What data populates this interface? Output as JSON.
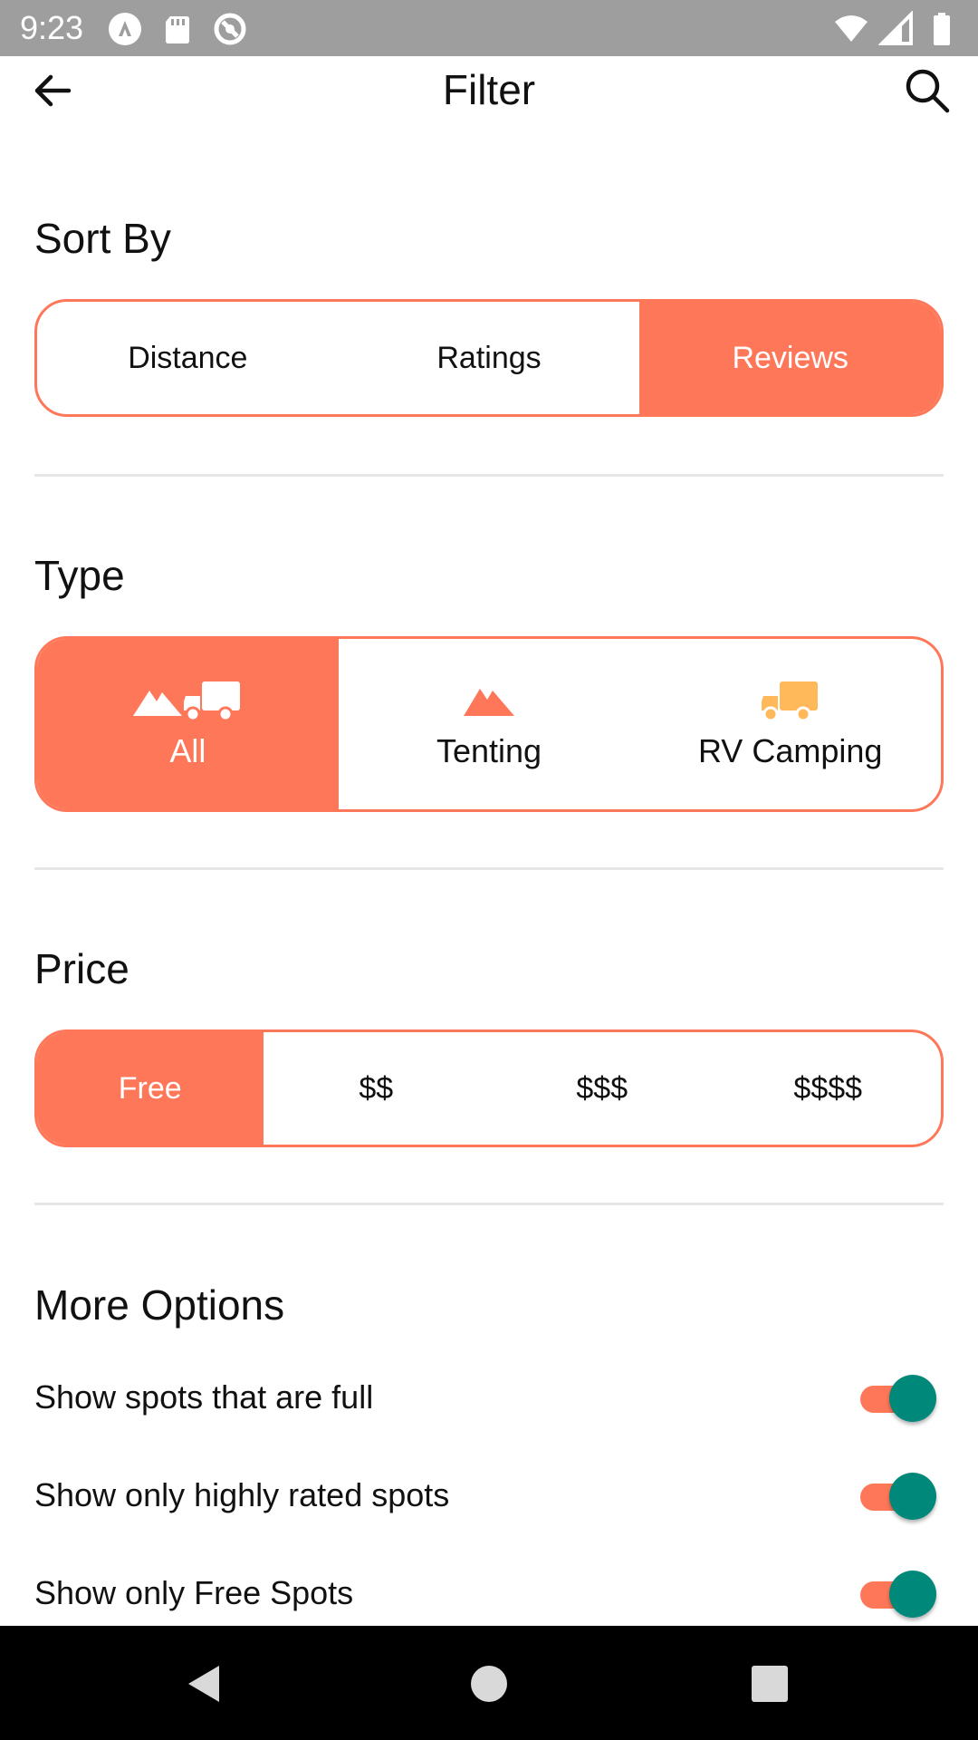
{
  "status_bar": {
    "time": "9:23",
    "icons_left": [
      "android-auto-icon",
      "sd-card-icon",
      "sync-icon"
    ],
    "icons_right": [
      "wifi-icon",
      "signal-icon",
      "battery-icon"
    ]
  },
  "app_bar": {
    "title": "Filter",
    "back_icon": "arrow-back-icon",
    "search_icon": "search-icon"
  },
  "sort_by": {
    "title": "Sort By",
    "options": [
      "Distance",
      "Ratings",
      "Reviews"
    ],
    "selected": "Reviews"
  },
  "type": {
    "title": "Type",
    "options": [
      {
        "label": "All",
        "icon": "tent-truck-icon"
      },
      {
        "label": "Tenting",
        "icon": "tent-icon"
      },
      {
        "label": "RV Camping",
        "icon": "truck-icon"
      }
    ],
    "selected": "All"
  },
  "price": {
    "title": "Price",
    "options": [
      "Free",
      "$$",
      "$$$",
      "$$$$"
    ],
    "selected": "Free"
  },
  "more_options": {
    "title": "More Options",
    "items": [
      {
        "label": "Show spots that are full",
        "on": true
      },
      {
        "label": "Show only highly rated spots",
        "on": true
      },
      {
        "label": "Show only Free Spots",
        "on": true
      }
    ]
  },
  "colors": {
    "accent": "#ff7759",
    "toggle_thumb": "#00897b",
    "rv_icon": "#ffb85a",
    "status_bar": "#9e9e9e"
  },
  "nav_bar": {
    "buttons": [
      "back-triangle-icon",
      "home-circle-icon",
      "recents-square-icon"
    ]
  }
}
